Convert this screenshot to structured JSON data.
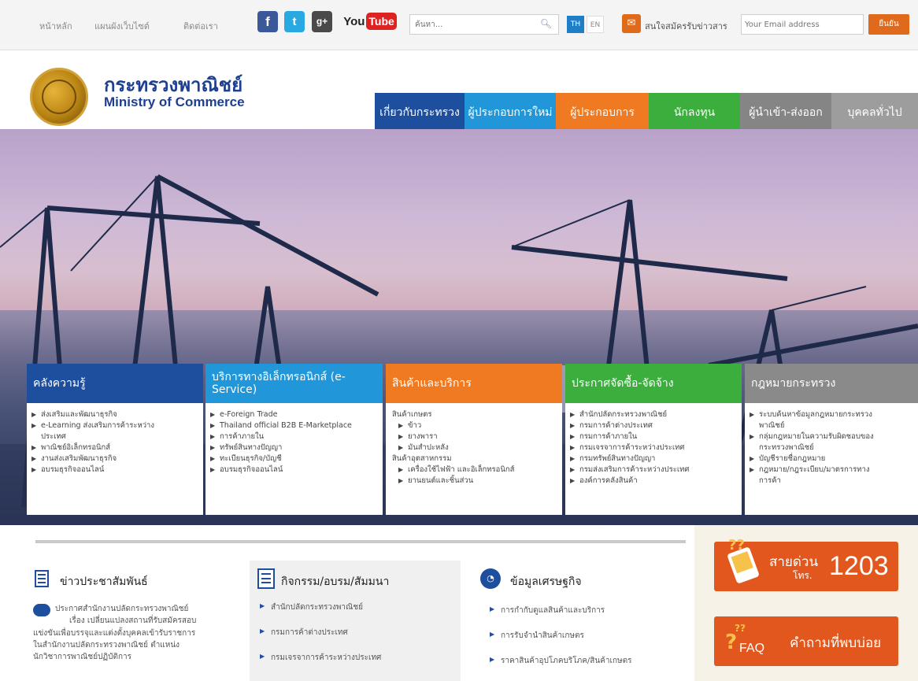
{
  "topbar": {
    "links": [
      "หน้าหลัก",
      "แผนผังเว็บไซต์",
      "ติดต่อเรา"
    ],
    "social": [
      "f",
      "t",
      "g+",
      "You",
      "Tube"
    ],
    "search_placeholder": "ค้นหา...",
    "lang_th": "TH",
    "lang_en": "EN",
    "subscribe_label": "สนใจสมัครรับข่าวสาร",
    "email_placeholder": "Your Email address",
    "subscribe_button": "ยืนยัน"
  },
  "header": {
    "title_th": "กระทรวงพาณิชย์",
    "title_en": "Ministry of Commerce"
  },
  "nav": [
    {
      "label": "เกี่ยวกับกระทรวง",
      "color": "#1e4f9f"
    },
    {
      "label": "ผู้ประกอบการใหม่",
      "color": "#2196d8"
    },
    {
      "label": "ผู้ประกอบการ",
      "color": "#f07a22"
    },
    {
      "label": "นักลงทุน",
      "color": "#3cae3e"
    },
    {
      "label": "ผู้นำเข้า-ส่งออก",
      "color": "#858585"
    },
    {
      "label": "บุคคลทั่วไป",
      "color": "#9d9d9d"
    }
  ],
  "panels": [
    {
      "title": "คลังความรู้",
      "color": "#1e4f9f",
      "items": [
        {
          "text": "ส่งเสริมและพัฒนาธุรกิจ"
        },
        {
          "text": "e-Learning ส่งเสริมการค้าระหว่าง"
        },
        {
          "text": "ประเทศ",
          "cont": true
        },
        {
          "text": "พาณิชย์อิเล็กทรอนิกส์"
        },
        {
          "text": "งานส่งเสริมพัฒนาธุรกิจ"
        },
        {
          "text": "อบรมธุรกิจออนไลน์"
        }
      ]
    },
    {
      "title": "บริการทางอิเล็กทรอนิกส์ (e-Service)",
      "color": "#2196d8",
      "items": [
        {
          "text": "e-Foreign Trade"
        },
        {
          "text": "Thailand official B2B E-Marketplace"
        },
        {
          "text": "การค้าภายใน"
        },
        {
          "text": "ทรัพย์สินทางปัญญา"
        },
        {
          "text": "ทะเบียนธุรกิจ/บัญชี"
        },
        {
          "text": "อบรมธุรกิจออนไลน์"
        }
      ]
    },
    {
      "title": "สินค้าและบริการ",
      "color": "#f07a22",
      "items": [
        {
          "text": "สินค้าเกษตร",
          "cont": true
        },
        {
          "text": "ข้าว",
          "sub": true
        },
        {
          "text": "ยางพารา",
          "sub": true
        },
        {
          "text": "มันสำปะหลัง",
          "sub": true
        },
        {
          "text": "สินค้าอุตสาหกรรม",
          "cont": true
        },
        {
          "text": "เครื่องใช้ไฟฟ้า และอิเล็กทรอนิกส์",
          "sub": true
        },
        {
          "text": "ยานยนต์และชิ้นส่วน",
          "sub": true
        }
      ]
    },
    {
      "title": "ประกาศจัดซื้อ-จัดจ้าง",
      "color": "#3cae3e",
      "items": [
        {
          "text": "สำนักปลัดกระทรวงพาณิชย์"
        },
        {
          "text": "กรมการค้าต่างประเทศ"
        },
        {
          "text": "กรมการค้าภายใน"
        },
        {
          "text": "กรมเจรจาการค้าระหว่างประเทศ"
        },
        {
          "text": "กรมทรัพย์สินทางปัญญา"
        },
        {
          "text": "กรมส่งเสริมการค้าระหว่างประเทศ"
        },
        {
          "text": "องค์การคลังสินค้า"
        }
      ]
    },
    {
      "title": "กฎหมายกระทรวง",
      "color": "#8a8a8a",
      "items": [
        {
          "text": "ระบบค้นหาข้อมูลกฎหมายกระทรวง"
        },
        {
          "text": "พาณิชย์",
          "cont": true
        },
        {
          "text": "กลุ่มกฎหมายในความรับผิดชอบของ"
        },
        {
          "text": "กระทรวงพาณิชย์",
          "cont": true
        },
        {
          "text": "บัญชีรายชื่อกฎหมาย"
        },
        {
          "text": "กฎหมาย/กฎระเบียบ/มาตรการทาง"
        },
        {
          "text": "การค้า",
          "cont": true
        }
      ]
    }
  ],
  "news": {
    "title": "ข่าวประชาสัมพันธ์",
    "lines": [
      "ประกาศสำนักงานปลัดกระทรวงพาณิชย์",
      "เรื่อง เปลี่ยนแปลงสถานที่รับสมัครสอบ",
      "แข่งขันเพื่อบรรจุและแต่งตั้งบุคคลเข้ารับราชการ",
      "ในสำนักงานปลัดกระทรวงพาณิชย์ ตำแหน่ง",
      "นักวิชาการพาณิชย์ปฏิบัติการ"
    ]
  },
  "activities": {
    "title": "กิจกรรม/อบรม/สัมมนา",
    "items": [
      "สำนักปลัดกระทรวงพาณิชย์",
      "กรมการค้าต่างประเทศ",
      "กรมเจรจาการค้าระหว่างประเทศ"
    ]
  },
  "economy": {
    "title": "ข้อมูลเศรษฐกิจ",
    "items": [
      "การกำกับดูแลสินค้าและบริการ",
      "การรับจำนำสินค้าเกษตร",
      "ราคาสินค้าอุปโภคบริโภค/สินค้าเกษตร"
    ]
  },
  "hotline": {
    "label": "สายด่วน",
    "prefix": "โทร.",
    "number": "1203"
  },
  "faq": {
    "badge": "FAQ",
    "label": "คำถามที่พบบ่อย"
  }
}
